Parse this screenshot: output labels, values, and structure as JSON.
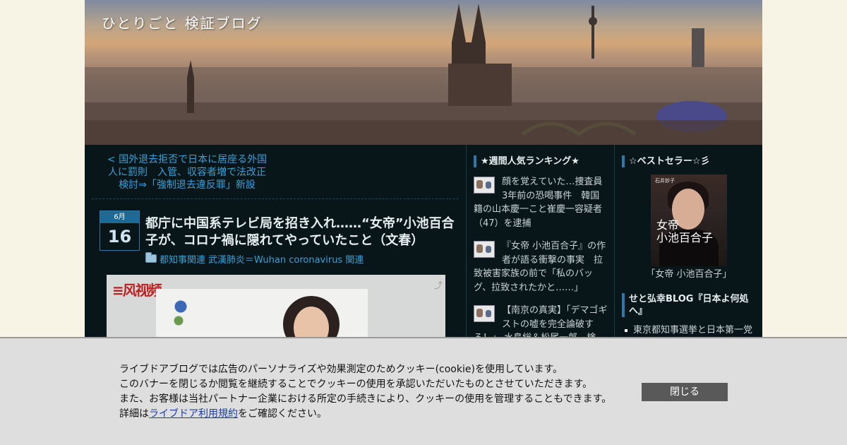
{
  "site": {
    "title": "ひとりごと 検証ブログ"
  },
  "main": {
    "prev_link": "< 国外退去拒否で日本に居座る外国人に罰則　入管、収容者増で法改正検討⇒「強制退去違反罪」新設",
    "date": {
      "month": "6月",
      "day": "16"
    },
    "post_title": "都庁に中国系テレビ局を招き入れ……“女帝”小池百合子が、コロナ禍に隠れてやっていたこと（文春）",
    "categories": [
      "都知事関連",
      "武漢肺炎＝Wuhan coronavirus 関連"
    ]
  },
  "ranking": {
    "heading": "★週間人気ランキング★",
    "items": [
      "顔を覚えていた…捜査員　3年前の恐喝事件　韓国籍の山本慶一こと崔慶一容疑者（47）を逮捕",
      "『女帝 小池百合子』の作者が語る衝撃の事実　拉致被害家族の前で「私のバッグ、拉致されたかと……」",
      "【南京の真実】「デマゴギストの嘘を完全論破する！」 水島総＆松尾一郎　検"
    ]
  },
  "bestseller": {
    "heading": "☆ベストセラー☆彡",
    "book_title_line1": "女帝",
    "book_title_line2": "小池百合子",
    "book_author": "石井妙子",
    "caption": "「女帝 小池百合子」"
  },
  "blog": {
    "heading": "せと弘幸BLOG『日本よ何処へ』",
    "items": [
      "東京都知事選挙と日本第一党"
    ]
  },
  "cookie": {
    "line1": "ライブドアブログでは広告のパーソナライズや効果測定のためクッキー(cookie)を使用しています。",
    "line2": "このバナーを閉じるか閲覧を継続することでクッキーの使用を承認いただいたものとさせていただきます。",
    "line3": "また、お客様は当社パートナー企業における所定の手続きにより、クッキーの使用を管理することもできます。",
    "line4_prefix": "詳細は",
    "line4_link": "ライブドア利用規約",
    "line4_suffix": "をご確認ください。",
    "close_label": "閉じる"
  }
}
